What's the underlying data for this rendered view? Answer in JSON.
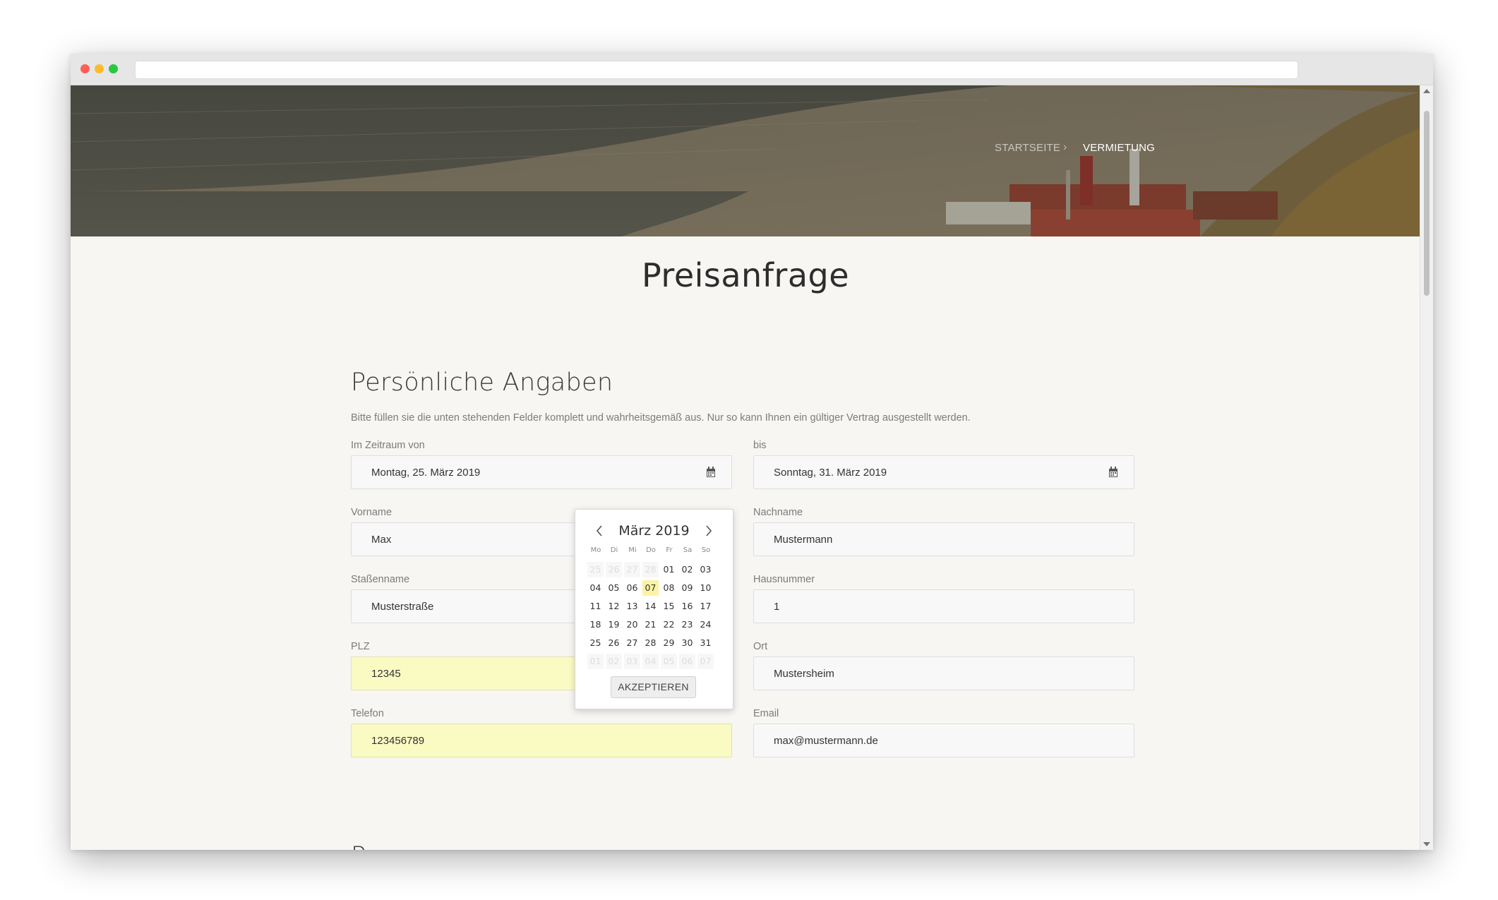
{
  "breadcrumb": {
    "home": "STARTSEITE",
    "separator": "›",
    "current": "VERMIETUNG"
  },
  "page_title": "Preisanfrage",
  "personal": {
    "title": "Persönliche Angaben",
    "description": "Bitte füllen sie die unten stehenden Felder komplett und wahrheitsgemäß aus. Nur so kann Ihnen ein gültiger Vertrag ausgestellt werden.",
    "from": {
      "label": "Im Zeitraum von",
      "value": "Montag, 25. März 2019"
    },
    "to": {
      "label": "bis",
      "value": "Sonntag, 31. März 2019"
    },
    "firstname": {
      "label": "Vorname",
      "value": "Max"
    },
    "lastname": {
      "label": "Nachname",
      "value": "Mustermann"
    },
    "street": {
      "label": "Staßenname",
      "value": "Musterstraße"
    },
    "housenumber": {
      "label": "Hausnummer",
      "value": "1"
    },
    "zip": {
      "label": "PLZ",
      "value": "12345"
    },
    "city": {
      "label": "Ort",
      "value": "Mustersheim"
    },
    "phone": {
      "label": "Telefon",
      "value": "123456789"
    },
    "email": {
      "label": "Email",
      "value": "max@mustermann.de"
    }
  },
  "next_section_title": "Personen",
  "datepicker": {
    "title": "März 2019",
    "weekdays": [
      "Mo",
      "Di",
      "Mi",
      "Do",
      "Fr",
      "Sa",
      "So"
    ],
    "weeks": [
      [
        "25",
        "26",
        "27",
        "28",
        "01",
        "02",
        "03"
      ],
      [
        "04",
        "05",
        "06",
        "07",
        "08",
        "09",
        "10"
      ],
      [
        "11",
        "12",
        "13",
        "14",
        "15",
        "16",
        "17"
      ],
      [
        "18",
        "19",
        "20",
        "21",
        "22",
        "23",
        "24"
      ],
      [
        "25",
        "26",
        "27",
        "28",
        "29",
        "30",
        "31"
      ],
      [
        "01",
        "02",
        "03",
        "04",
        "05",
        "06",
        "07"
      ]
    ],
    "highlighted_day": "07",
    "accept_label": "AKZEPTIEREN"
  },
  "colors": {
    "autofill": "#fafbc3",
    "today_highlight": "#fdf3a5",
    "page_background": "#f7f6f3"
  }
}
